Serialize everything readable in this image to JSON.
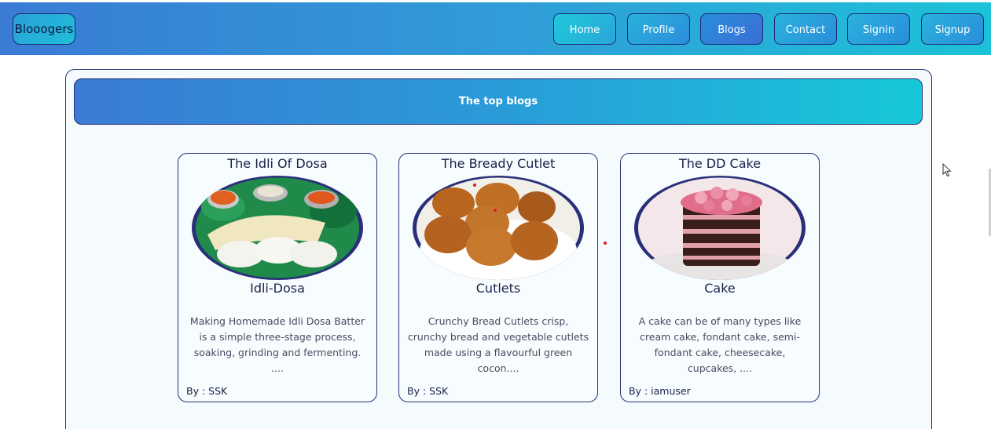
{
  "navbar": {
    "brand": "Blooogers",
    "items": [
      "Home",
      "Profile",
      "Blogs",
      "Contact",
      "Signin",
      "Signup"
    ]
  },
  "banner": {
    "title": "The top blogs"
  },
  "cards": [
    {
      "title": "The Idli Of Dosa",
      "image_icon": "idli-dosa-image",
      "subtitle": "Idli-Dosa",
      "description": "Making Homemade Idli Dosa Batter is a simple three-stage process, soaking, grinding and fermenting. ....",
      "author": "By : SSK"
    },
    {
      "title": "The Bready Cutlet",
      "image_icon": "cutlets-image",
      "subtitle": "Cutlets",
      "description": "Crunchy Bread Cutlets crisp, crunchy bread and vegetable cutlets made using a flavourful green cocon....",
      "author": "By : SSK"
    },
    {
      "title": "The DD Cake",
      "image_icon": "cake-image",
      "subtitle": "Cake",
      "description": "A cake can be of many types like cream cake, fondant cake, semi-fondant cake, cheesecake, cupcakes, ....",
      "author": "By : iamuser"
    }
  ],
  "colors": {
    "nav_gradient_start": "#3a7bd5",
    "nav_gradient_end": "#1cc2d8",
    "border": "#2a2f7a"
  }
}
